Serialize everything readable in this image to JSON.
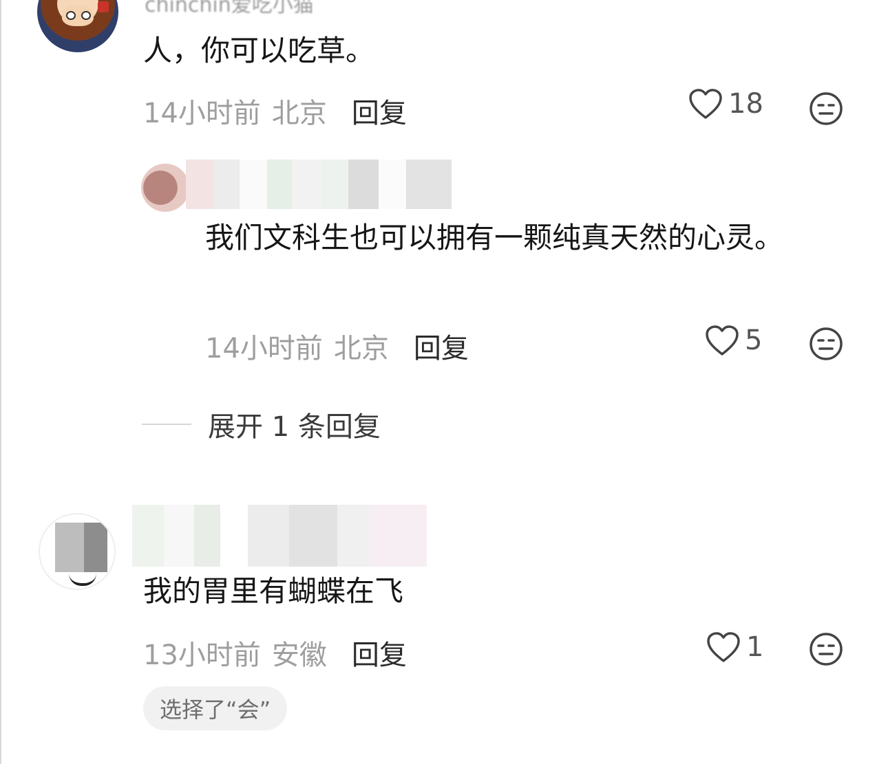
{
  "comments": [
    {
      "author": "chinchin爱吃小猫",
      "content": "人，你可以吃草。",
      "time": "14小时前",
      "location": "北京",
      "reply_label": "回复",
      "likes": "18"
    },
    {
      "author": "",
      "content": "我们文科生也可以拥有一颗纯真天然的心灵。",
      "time": "14小时前",
      "location": "北京",
      "reply_label": "回复",
      "likes": "5"
    },
    {
      "author": "",
      "content": "我的胃里有蝴蝶在飞",
      "time": "13小时前",
      "location": "安徽",
      "reply_label": "回复",
      "likes": "1",
      "chip": "选择了“会”"
    }
  ],
  "expand_replies": "展开 1 条回复",
  "icons": [
    "heart-icon",
    "emoji-react-icon"
  ],
  "colors": {
    "meta": "#9e9e9e",
    "text": "#161616",
    "chip_bg": "#f1f1f1"
  }
}
